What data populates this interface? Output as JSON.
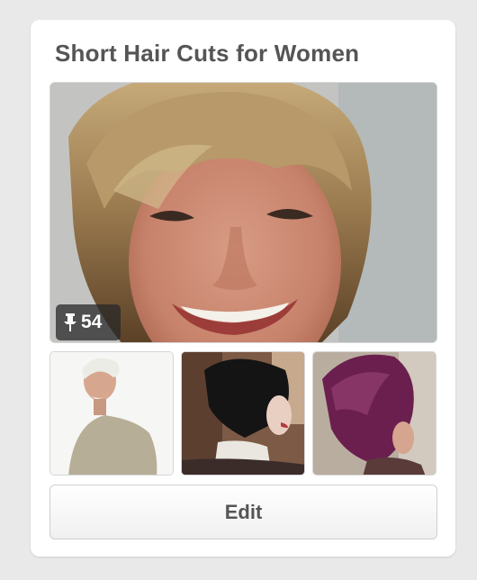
{
  "board": {
    "title": "Short Hair Cuts for Women",
    "pin_count": "54",
    "edit_label": "Edit",
    "cover_image": "woman-short-blonde-hair-smiling",
    "thumbnails": [
      "woman-short-white-hair",
      "black-bob-haircut",
      "purple-bob-haircut"
    ]
  },
  "colors": {
    "background": "#e9e9e9",
    "card": "#ffffff",
    "title_text": "#555555",
    "badge_bg": "#2f2f2f",
    "purple_hair": "#6b1f4e"
  },
  "icons": {
    "pin": "pin-icon"
  }
}
